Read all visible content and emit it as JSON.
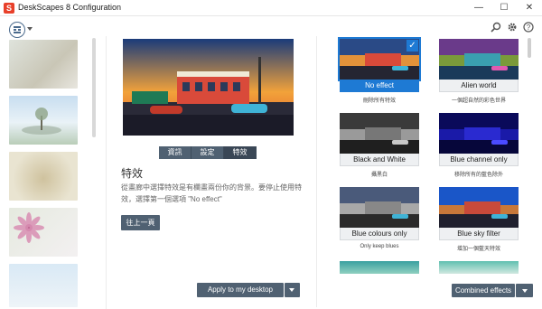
{
  "window": {
    "title": "DeskScapes 8 Configuration",
    "logo_letter": "S",
    "controls": {
      "minimize": "—",
      "maximize": "☐",
      "close": "✕"
    }
  },
  "toolbar": {
    "view_icon": "grid-view-icon",
    "search_icon": "search-icon",
    "settings_icon": "gear-icon",
    "help_icon": "help-icon"
  },
  "center": {
    "tabs": [
      {
        "label": "資訊",
        "selected": false
      },
      {
        "label": "設定",
        "selected": false
      },
      {
        "label": "特效",
        "selected": true
      }
    ],
    "effect_title": "特效",
    "effect_desc": "從畫廊中選擇特效是有欄畫兩份你的背景。要停止使用特效，選擇第一個選項 \"No effect\"",
    "back_label": "往上一頁",
    "apply_label": "Apply to my desktop"
  },
  "effects": [
    {
      "name": "No effect",
      "desc": "刪除所有特效",
      "selected": true
    },
    {
      "name": "Alien world",
      "desc": "一個超自然的彩色世界",
      "selected": false
    },
    {
      "name": "Black and White",
      "desc": "攝黑白",
      "selected": false
    },
    {
      "name": "Blue channel only",
      "desc": "移除所有的藍色除外",
      "selected": false
    },
    {
      "name": "Blue colours only",
      "desc": "Only keep blues",
      "selected": false
    },
    {
      "name": "Blue sky filter",
      "desc": "增加一個藍天特效",
      "selected": false
    }
  ],
  "combined_label": "Combined effects",
  "colors": {
    "accent": "#1e7ad4",
    "button": "#506172"
  }
}
